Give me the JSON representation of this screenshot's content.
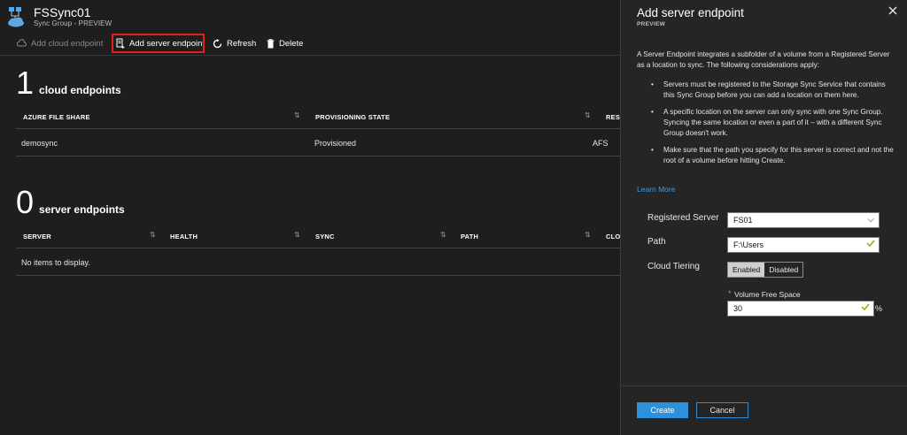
{
  "blade": {
    "title": "FSSync01",
    "subtitle": "Sync Group - PREVIEW"
  },
  "toolbar": {
    "add_cloud_endpoint": "Add cloud endpoint",
    "add_server_endpoint": "Add server endpoint",
    "refresh": "Refresh",
    "delete": "Delete"
  },
  "cloud_endpoints": {
    "count": "1",
    "label": "cloud endpoints",
    "columns": [
      "AZURE FILE SHARE",
      "PROVISIONING STATE",
      "RESO"
    ],
    "rows": [
      {
        "azure_file_share": "demosync",
        "provisioning_state": "Provisioned",
        "resource": "AFS"
      }
    ]
  },
  "server_endpoints": {
    "count": "0",
    "label": "server endpoints",
    "columns": [
      "SERVER",
      "HEALTH",
      "SYNC",
      "PATH",
      "CLOU"
    ],
    "empty_text": "No items to display."
  },
  "panel": {
    "title": "Add server endpoint",
    "preview": "PREVIEW",
    "intro": "A Server Endpoint integrates a subfolder of a volume from a Registered Server as a location to sync. The following considerations apply:",
    "bullets": [
      "Servers must be registered to the Storage Sync Service that contains this Sync Group before you can add a location on them here.",
      "A specific location on the server can only sync with one Sync Group. Syncing the same location or even a part of it – with a different Sync Group doesn't work.",
      "Make sure that the path you specify for this server is correct and not the root of a volume before hitting Create."
    ],
    "learn_more": "Learn More",
    "registered_server_label": "Registered Server",
    "registered_server_value": "FS01",
    "path_label": "Path",
    "path_value": "F:\\Users",
    "cloud_tiering_label": "Cloud Tiering",
    "tiering_enabled": "Enabled",
    "tiering_disabled": "Disabled",
    "volume_free_space_required": "*",
    "volume_free_space_label": "Volume Free Space",
    "volume_free_space_value": "30",
    "volume_free_space_unit": "%",
    "create": "Create",
    "cancel": "Cancel"
  },
  "colors": {
    "accent": "#2e8fda",
    "link": "#3e9ce8",
    "highlight_box": "#e0201f",
    "valid_check": "#7fba00"
  }
}
